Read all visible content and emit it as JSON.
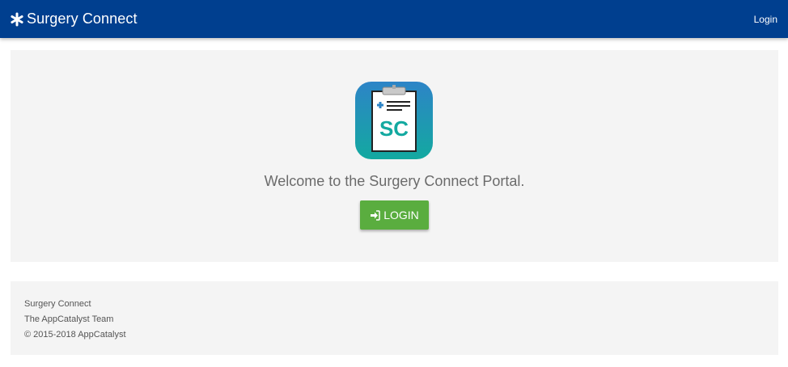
{
  "navbar": {
    "brand_icon": "asterisk-icon",
    "brand_title": "Surgery Connect",
    "login_link": "Login",
    "background_color": "#003f8f"
  },
  "hero": {
    "logo_icon": "clipboard-sc-logo",
    "logo_text": "SC",
    "welcome_text": "Welcome to the Surgery Connect Portal.",
    "login_button_icon": "sign-in-icon",
    "login_button_label": "LOGIN",
    "login_button_color": "#5aad3f"
  },
  "footer": {
    "line1": "Surgery Connect",
    "line2": "The AppCatalyst Team",
    "line3": "© 2015-2018 AppCatalyst"
  }
}
